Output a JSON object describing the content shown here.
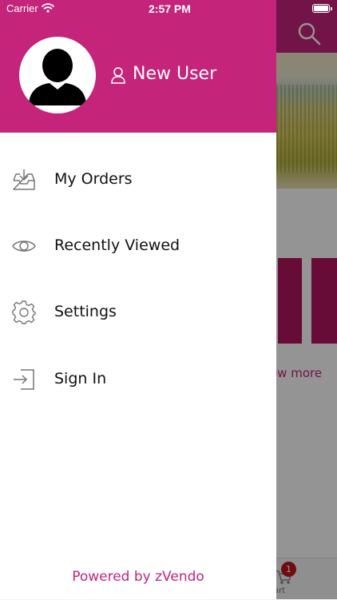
{
  "status_bar": {
    "carrier": "Carrier",
    "time": "2:57 PM"
  },
  "drawer": {
    "user_name": "New User",
    "menu": [
      {
        "label": "My Orders",
        "icon": "inbox-download-icon"
      },
      {
        "label": "Recently Viewed",
        "icon": "eye-icon"
      },
      {
        "label": "Settings",
        "icon": "gear-icon"
      },
      {
        "label": "Sign In",
        "icon": "sign-in-icon"
      }
    ],
    "footer": "Powered by zVendo"
  },
  "background": {
    "show_more_partial": "ow more",
    "cart_badge": "1",
    "cart_label_partial": "art"
  },
  "colors": {
    "brand": "#c4247a",
    "badge": "#c0161c"
  }
}
